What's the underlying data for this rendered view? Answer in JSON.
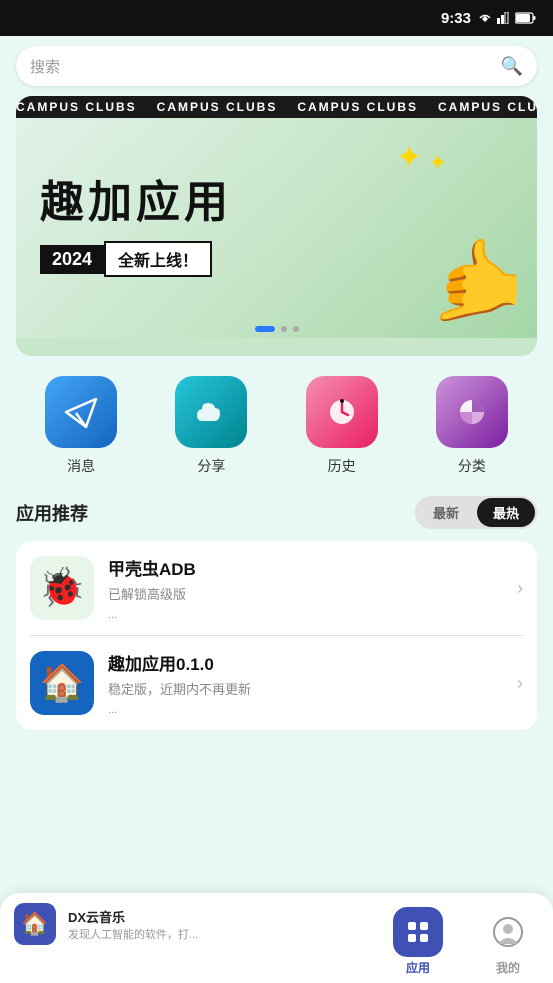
{
  "statusBar": {
    "time": "9:33"
  },
  "searchBar": {
    "placeholder": "搜索",
    "icon": "🔍"
  },
  "banner": {
    "ticker": [
      "CAMPUS CLUBS",
      "CAMPUS CLUBS",
      "CAMPUS CLUBS",
      "CAMPUS CLUBS",
      "CAMPUS CLUBS",
      "CAMPUS CLUBS"
    ],
    "title": "趣加应用",
    "year": "2024",
    "desc": "全新上线！",
    "dots": [
      1,
      2,
      3
    ],
    "activeDot": 1
  },
  "quickActions": [
    {
      "label": "消息",
      "icon": "✈️",
      "color": "blue"
    },
    {
      "label": "分享",
      "icon": "☁️",
      "color": "teal"
    },
    {
      "label": "历史",
      "icon": "⏰",
      "color": "pink"
    },
    {
      "label": "分类",
      "icon": "⬡",
      "color": "purple"
    }
  ],
  "appRecommend": {
    "title": "应用推荐",
    "tabs": [
      {
        "label": "最新",
        "active": false
      },
      {
        "label": "最热",
        "active": true
      }
    ]
  },
  "apps": [
    {
      "name": "甲壳虫ADB",
      "desc": "已解锁高级版",
      "icon": "ladybug",
      "more": "..."
    },
    {
      "name": "趣加应用0.1.0",
      "desc": "稳定版，近期内不再更新",
      "icon": "house",
      "more": "..."
    }
  ],
  "bottomNav": [
    {
      "label": "应用",
      "icon": "🏠",
      "active": true
    },
    {
      "label": "我的",
      "icon": "😊",
      "active": false
    }
  ],
  "miniPlayer": {
    "title": "DX云音乐",
    "desc": "发现人工智能的软件，打..."
  }
}
